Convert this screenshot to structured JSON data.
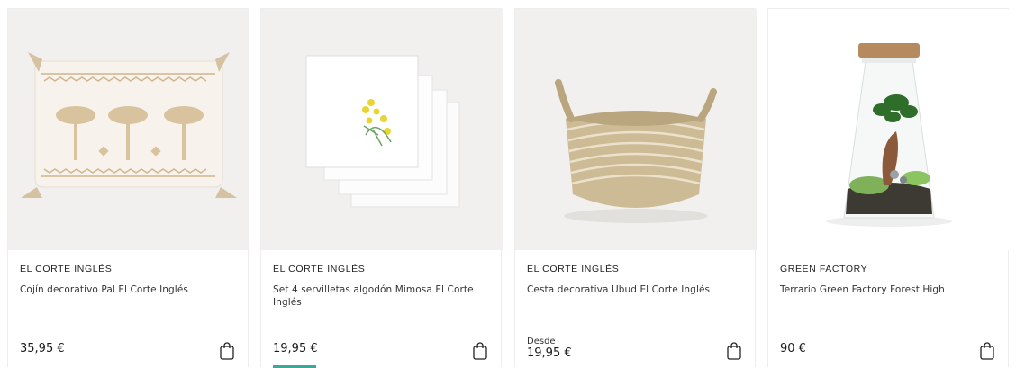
{
  "products": [
    {
      "brand": "EL CORTE INGLÉS",
      "name": "Cojín decorativo Pal El Corte Inglés",
      "price_prefix": "",
      "price": "35,95 €",
      "image_icon": "cushion-palm-icon"
    },
    {
      "brand": "EL CORTE INGLÉS",
      "name": "Set 4 servilletas algodón Mimosa El Corte Inglés",
      "price_prefix": "",
      "price": "19,95 €",
      "image_icon": "napkins-mimosa-icon"
    },
    {
      "brand": "EL CORTE INGLÉS",
      "name": "Cesta decorativa Ubud El Corte Inglés",
      "price_prefix": "Desde",
      "price": "19,95 €",
      "image_icon": "basket-icon"
    },
    {
      "brand": "GREEN FACTORY",
      "name": "Terrario Green Factory Forest High",
      "price_prefix": "",
      "price": "90 €",
      "image_icon": "terrarium-icon"
    }
  ],
  "colors": {
    "image_bg": "#f1f0ee",
    "text": "#1a1a1a",
    "accent": "#3aa89a"
  },
  "cart_icon": "shopping-bag-icon"
}
